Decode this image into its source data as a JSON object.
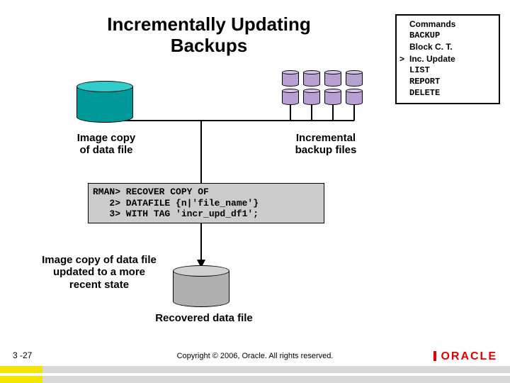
{
  "title": "Incrementally Updating Backups",
  "commands": {
    "header": "Commands",
    "items": [
      {
        "text": "BACKUP",
        "mono": true,
        "selected": false
      },
      {
        "text": "Block C. T.",
        "mono": false,
        "selected": false
      },
      {
        "text": "Inc. Update",
        "mono": false,
        "selected": true
      },
      {
        "text": "LIST",
        "mono": true,
        "selected": false
      },
      {
        "text": "REPORT",
        "mono": true,
        "selected": false
      },
      {
        "text": "DELETE",
        "mono": true,
        "selected": false
      }
    ],
    "marker": ">"
  },
  "labels": {
    "image_copy": "Image copy\nof data file",
    "incremental": "Incremental\nbackup files",
    "updated": "Image copy of data file\nupdated to a more\nrecent state",
    "recovered": "Recovered data file"
  },
  "code": "RMAN> RECOVER COPY OF\n   2> DATAFILE {n|'file_name'}\n   3> WITH TAG 'incr_upd_df1';",
  "footer": {
    "slide": "3 -27",
    "copyright": "Copyright © 2006, Oracle. All rights reserved.",
    "logo": "ORACLE"
  }
}
